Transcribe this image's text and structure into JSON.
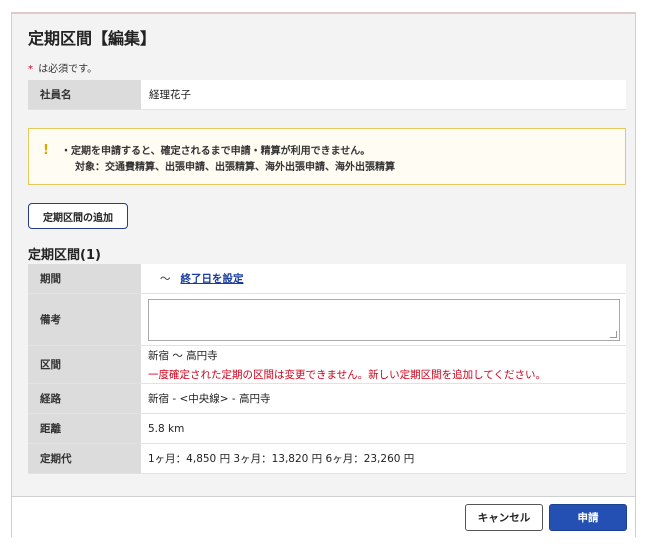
{
  "dialog": {
    "title": "定期区間【編集】",
    "required_mark": "*",
    "required_note": "は必須です。"
  },
  "employee": {
    "label": "社員名",
    "value": "経理花子"
  },
  "warning": {
    "icon": "!",
    "line1": "・定期を申請すると、確定されるまで申請・精算が利用できません。",
    "line2": "対象：交通費精算、出張申請、出張精算、海外出張申請、海外出張精算"
  },
  "add_button_label": "定期区間の追加",
  "section_title": "定期区間(1)",
  "fields": {
    "period": {
      "label": "期間",
      "separator": "～",
      "link": "終了日を設定"
    },
    "remarks": {
      "label": "備考",
      "value": ""
    },
    "section": {
      "label": "区間",
      "value": "新宿 ～ 高円寺",
      "error": "一度確定された定期の区間は変更できません。新しい定期区間を追加してください。"
    },
    "route": {
      "label": "経路",
      "value": "新宿 - <中央線> - 高円寺"
    },
    "distance": {
      "label": "距離",
      "value": "5.8 km"
    },
    "fare": {
      "label": "定期代",
      "value": "1ヶ月：4,850 円  3ヶ月：13,820 円  6ヶ月：23,260 円"
    }
  },
  "footer": {
    "cancel_label": "キャンセル",
    "submit_label": "申請"
  },
  "colors": {
    "accent": "#2450b4",
    "error": "#d0021b",
    "warning_border": "#e7c75a",
    "header_cell": "#dcdcdc"
  }
}
